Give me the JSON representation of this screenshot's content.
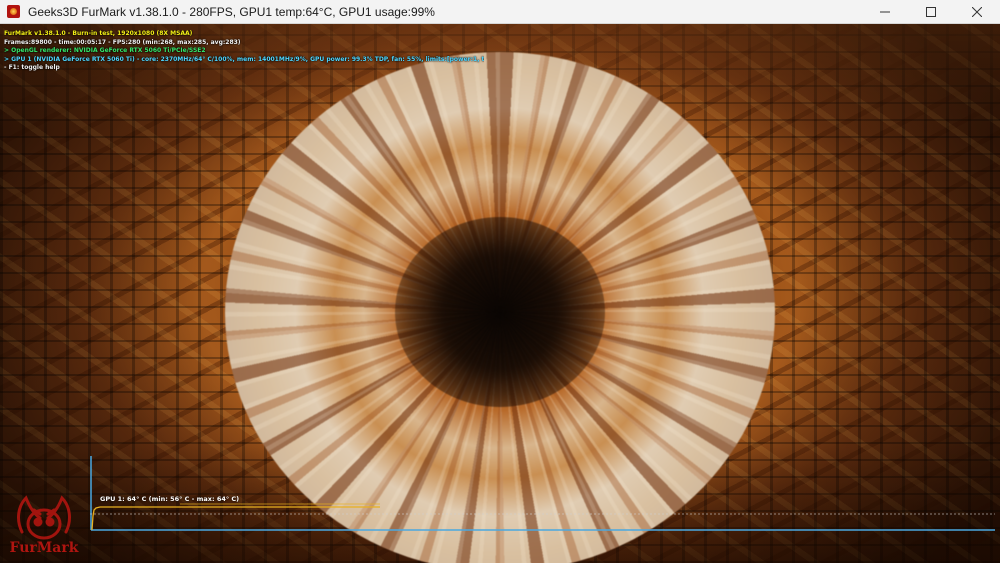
{
  "window": {
    "title": "Geeks3D FurMark v1.38.1.0 - 280FPS, GPU1 temp:64°C, GPU1 usage:99%",
    "controls": [
      "minimize",
      "maximize",
      "close"
    ]
  },
  "hud": {
    "line1": "FurMark v1.38.1.0 - Burn-in test, 1920x1080 (8X MSAA)",
    "line2": "Frames:89800 - time:00:05:17 - FPS:280 (min:268, max:285, avg:283)",
    "line3": "> OpenGL renderer: NVIDIA GeForce RTX 5060 Ti/PCIe/SSE2",
    "line4": "> GPU 1 (NVIDIA GeForce RTX 5060 Ti) - core: 2370MHz/64° C/100%, mem: 14001MHz/9%, GPU power: 99.3% TDP, fan: 55%, limits:[power:1, temp:0, volt:0, OV:0]",
    "line5": "- F1: toggle help",
    "colors": {
      "title": "#f5f016",
      "stats": "#f2f2f2",
      "renderer": "#35e86a",
      "gpu": "#4fd7ff"
    }
  },
  "graph": {
    "label": "GPU 1: 64° C (min: 56° C - max: 64° C)",
    "current_temp_c": 64,
    "min_temp_c": 56,
    "max_temp_c": 64,
    "line_color": "#e8b020",
    "axis_color": "#4aa8e0"
  },
  "logo": {
    "text": "FurMark",
    "color": "#b01510"
  }
}
